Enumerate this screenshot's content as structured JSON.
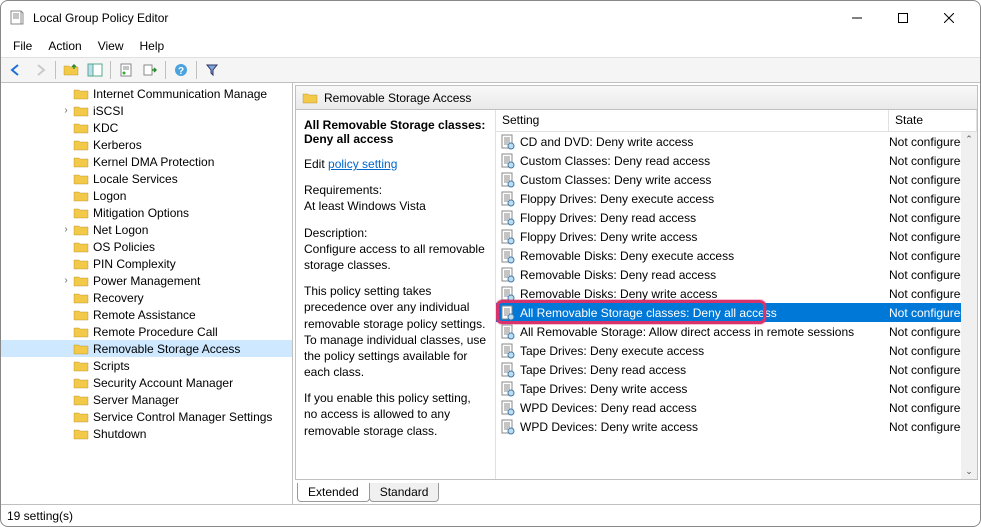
{
  "window": {
    "title": "Local Group Policy Editor"
  },
  "menu": [
    "File",
    "Action",
    "View",
    "Help"
  ],
  "tree": [
    {
      "d": 3,
      "e": "",
      "l": "Internet Communication Manage"
    },
    {
      "d": 3,
      "e": ">",
      "l": "iSCSI"
    },
    {
      "d": 3,
      "e": "",
      "l": "KDC"
    },
    {
      "d": 3,
      "e": "",
      "l": "Kerberos"
    },
    {
      "d": 3,
      "e": "",
      "l": "Kernel DMA Protection"
    },
    {
      "d": 3,
      "e": "",
      "l": "Locale Services"
    },
    {
      "d": 3,
      "e": "",
      "l": "Logon"
    },
    {
      "d": 3,
      "e": "",
      "l": "Mitigation Options"
    },
    {
      "d": 3,
      "e": ">",
      "l": "Net Logon"
    },
    {
      "d": 3,
      "e": "",
      "l": "OS Policies"
    },
    {
      "d": 3,
      "e": "",
      "l": "PIN Complexity"
    },
    {
      "d": 3,
      "e": ">",
      "l": "Power Management"
    },
    {
      "d": 3,
      "e": "",
      "l": "Recovery"
    },
    {
      "d": 3,
      "e": "",
      "l": "Remote Assistance"
    },
    {
      "d": 3,
      "e": "",
      "l": "Remote Procedure Call"
    },
    {
      "d": 3,
      "e": "",
      "l": "Removable Storage Access",
      "sel": true
    },
    {
      "d": 3,
      "e": "",
      "l": "Scripts"
    },
    {
      "d": 3,
      "e": "",
      "l": "Security Account Manager"
    },
    {
      "d": 3,
      "e": "",
      "l": "Server Manager"
    },
    {
      "d": 3,
      "e": "",
      "l": "Service Control Manager Settings"
    },
    {
      "d": 3,
      "e": "",
      "l": "Shutdown"
    }
  ],
  "detailsHeader": "Removable Storage Access",
  "descPane": {
    "title": "All Removable Storage classes: Deny all access",
    "editPrefix": "Edit ",
    "editLink": "policy setting",
    "reqLabel": "Requirements:",
    "reqText": "At least Windows Vista",
    "descLabel": "Description:",
    "descText": "Configure access to all removable storage classes.",
    "para1": "This policy setting takes precedence over any individual removable storage policy settings. To manage individual classes, use the policy settings available for each class.",
    "para2": "If you enable this policy setting, no access is allowed to any removable storage class."
  },
  "columns": {
    "setting": "Setting",
    "state": "State"
  },
  "settings": [
    {
      "name": "CD and DVD: Deny write access",
      "state": "Not configured"
    },
    {
      "name": "Custom Classes: Deny read access",
      "state": "Not configured"
    },
    {
      "name": "Custom Classes: Deny write access",
      "state": "Not configured"
    },
    {
      "name": "Floppy Drives: Deny execute access",
      "state": "Not configured"
    },
    {
      "name": "Floppy Drives: Deny read access",
      "state": "Not configured"
    },
    {
      "name": "Floppy Drives: Deny write access",
      "state": "Not configured"
    },
    {
      "name": "Removable Disks: Deny execute access",
      "state": "Not configured"
    },
    {
      "name": "Removable Disks: Deny read access",
      "state": "Not configured"
    },
    {
      "name": "Removable Disks: Deny write access",
      "state": "Not configured"
    },
    {
      "name": "All Removable Storage classes: Deny all access",
      "state": "Not configured",
      "selected": true,
      "highlight": true
    },
    {
      "name": "All Removable Storage: Allow direct access in remote sessions",
      "state": "Not configured"
    },
    {
      "name": "Tape Drives: Deny execute access",
      "state": "Not configured"
    },
    {
      "name": "Tape Drives: Deny read access",
      "state": "Not configured"
    },
    {
      "name": "Tape Drives: Deny write access",
      "state": "Not configured"
    },
    {
      "name": "WPD Devices: Deny read access",
      "state": "Not configured"
    },
    {
      "name": "WPD Devices: Deny write access",
      "state": "Not configured"
    }
  ],
  "tabs": {
    "extended": "Extended",
    "standard": "Standard"
  },
  "status": "19 setting(s)"
}
